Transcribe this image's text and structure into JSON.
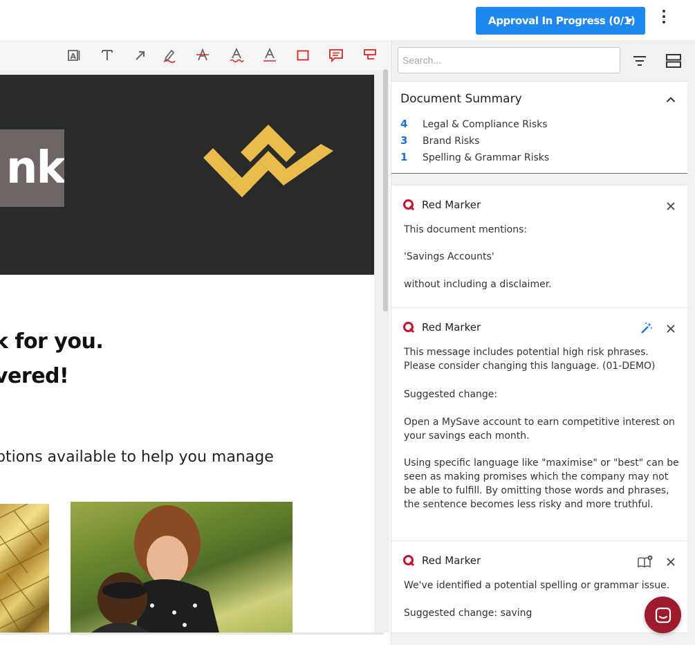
{
  "header": {
    "approval_label": "Approval In Progress (0/1)"
  },
  "toolbar": {
    "tools": [
      "text-box-icon",
      "text-icon",
      "arrow-icon",
      "highlight-pen-icon",
      "strikethrough-icon",
      "squiggly-underline-icon",
      "underline-icon",
      "rectangle-icon",
      "comment-icon",
      "callout-icon"
    ]
  },
  "document": {
    "brand_fragment": "nk",
    "headline_1": "k for you.",
    "headline_2": "vered!",
    "body_line": "ptions available to help you manage"
  },
  "sidebar": {
    "search_placeholder": "Search...",
    "summary": {
      "title": "Document Summary",
      "rows": [
        {
          "count": "4",
          "label": "Legal & Compliance Risks"
        },
        {
          "count": "3",
          "label": "Brand Risks"
        },
        {
          "count": "1",
          "label": "Spelling & Grammar Risks"
        }
      ]
    },
    "cards": [
      {
        "title": "Red Marker",
        "lines": [
          "This document mentions:",
          "'Savings Accounts'",
          "without including a disclaimer."
        ]
      },
      {
        "title": "Red Marker",
        "para1": "This message includes potential high risk phrases. Please consider changing this language. (01-DEMO)",
        "para2": "Suggested change:",
        "para3": "Open a MySave account to earn competitive interest on your savings each month.",
        "para4": "Using specific language like \"maximise\" or \"best\" can be seen as making promises which the company may not be able to fulfill. By omitting those words and phrases, the sentence becomes less risky and more truthful."
      },
      {
        "title": "Red Marker",
        "para1": "We've identified a potential spelling or grammar issue.",
        "para2": "Suggested change: saving"
      }
    ]
  },
  "colors": {
    "accent": "#1f87f0",
    "red_marker": "#c8102e",
    "hero_bg": "#2b2a2b",
    "logo_gold": "#e9bd4c",
    "chat": "#9e1b2e"
  }
}
